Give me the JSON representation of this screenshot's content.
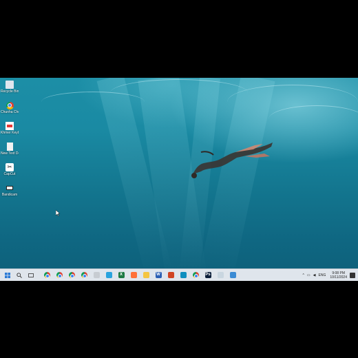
{
  "desktop": {
    "icons": [
      {
        "name": "recycle-bin",
        "label": "Recycle Bin",
        "glyph": "🗑",
        "color": "#dfe6ee"
      },
      {
        "name": "chrome-shortcut",
        "label": "Chunha Chrome",
        "glyph": "chrome",
        "color": "#4285f4"
      },
      {
        "name": "pdf-document",
        "label": "Khmer Keyboa...",
        "glyph": "▤",
        "color": "#e53935"
      },
      {
        "name": "text-document",
        "label": "New Text Document",
        "glyph": "▤",
        "color": "#f2f2f2"
      },
      {
        "name": "capcut",
        "label": "CapCut",
        "glyph": "✂",
        "color": "#ffffff"
      },
      {
        "name": "screen-recorder",
        "label": "Bandicam",
        "glyph": "■",
        "color": "#f2f2f2"
      }
    ]
  },
  "taskbar": {
    "start_icon": "windows-logo-icon",
    "search_icon": "search-icon",
    "task_view_icon": "task-view-icon",
    "apps": [
      {
        "name": "chrome",
        "label": "",
        "type": "chrome"
      },
      {
        "name": "chrome",
        "label": "",
        "type": "chrome"
      },
      {
        "name": "chrome",
        "label": "",
        "type": "chrome"
      },
      {
        "name": "chrome",
        "label": "",
        "type": "chrome"
      },
      {
        "name": "app-pinned",
        "label": "",
        "type": "box",
        "color": "#c7ccd2"
      },
      {
        "name": "telegram",
        "label": "",
        "type": "box",
        "color": "#2aa3de"
      },
      {
        "name": "excel",
        "label": "X",
        "type": "box",
        "color": "#1e7a44"
      },
      {
        "name": "firefox",
        "label": "",
        "type": "box",
        "color": "#ff7139"
      },
      {
        "name": "file-explorer",
        "label": "",
        "type": "box",
        "color": "#f4c542"
      },
      {
        "name": "word",
        "label": "W",
        "type": "box",
        "color": "#2b5fb4"
      },
      {
        "name": "powerpoint",
        "label": "",
        "type": "box",
        "color": "#d04423"
      },
      {
        "name": "edge",
        "label": "",
        "type": "box",
        "color": "#0f8fbf"
      },
      {
        "name": "chrome",
        "label": "",
        "type": "chrome"
      },
      {
        "name": "photoshop",
        "label": "Ps",
        "type": "box",
        "color": "#0b1e3a"
      },
      {
        "name": "app-pinned",
        "label": "",
        "type": "box",
        "color": "#c9d6e0"
      },
      {
        "name": "app-pinned",
        "label": "",
        "type": "box",
        "color": "#3b8bd4"
      }
    ],
    "tray": {
      "chevron": "^",
      "language": "ENG",
      "time": "9:08 PM",
      "date": "10/11/2024"
    }
  }
}
